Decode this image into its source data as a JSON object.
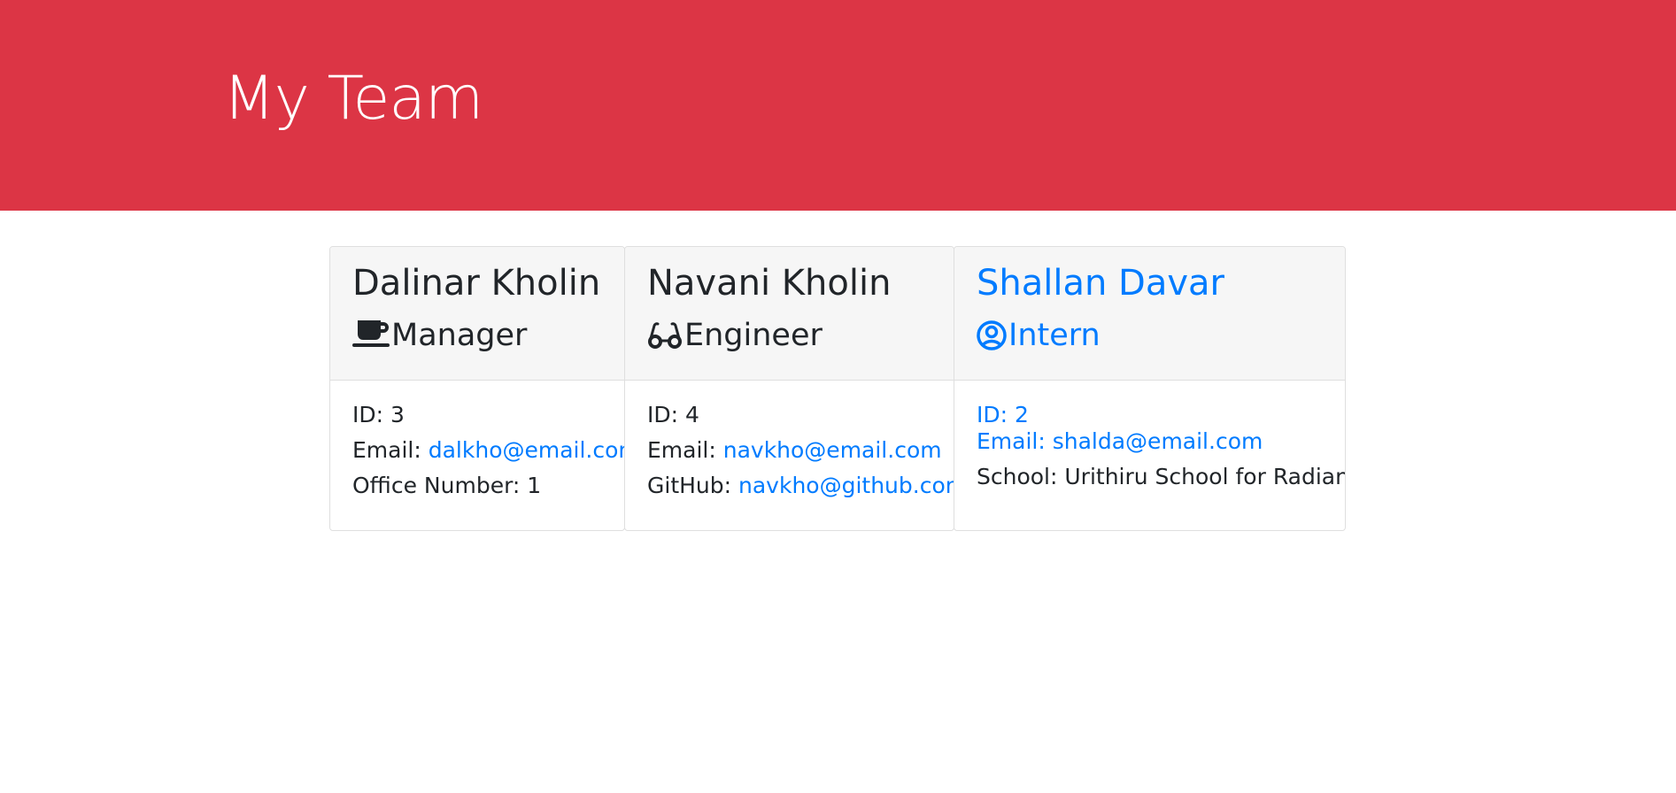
{
  "header": {
    "title": "My Team",
    "bg_color": "#dc3545"
  },
  "team": [
    {
      "name": "Dalinar Kholin",
      "role": "Manager",
      "role_icon": "coffee-mug-icon",
      "id_label": "ID: 3",
      "email_label": "Email: ",
      "email": "dalkho@email.com",
      "extra_label": "Office Number: 1",
      "extra_value": ""
    },
    {
      "name": "Navani Kholin",
      "role": "Engineer",
      "role_icon": "glasses-icon",
      "id_label": "ID: 4",
      "email_label": "Email: ",
      "email": "navkho@email.com",
      "extra_label": "GitHub: ",
      "extra_value": "navkho@github.com"
    },
    {
      "name": "Shallan Davar",
      "role": "Intern",
      "role_icon": "user-circle-icon",
      "id_label": "ID: 2",
      "email_label": "Email: ",
      "email": "shalda@email.com",
      "extra_label": "School: Urithiru School for Radiants",
      "extra_value": ""
    }
  ],
  "colors": {
    "link": "#007bff",
    "card_header_bg": "#f6f6f6",
    "border": "#dfdfdf"
  }
}
